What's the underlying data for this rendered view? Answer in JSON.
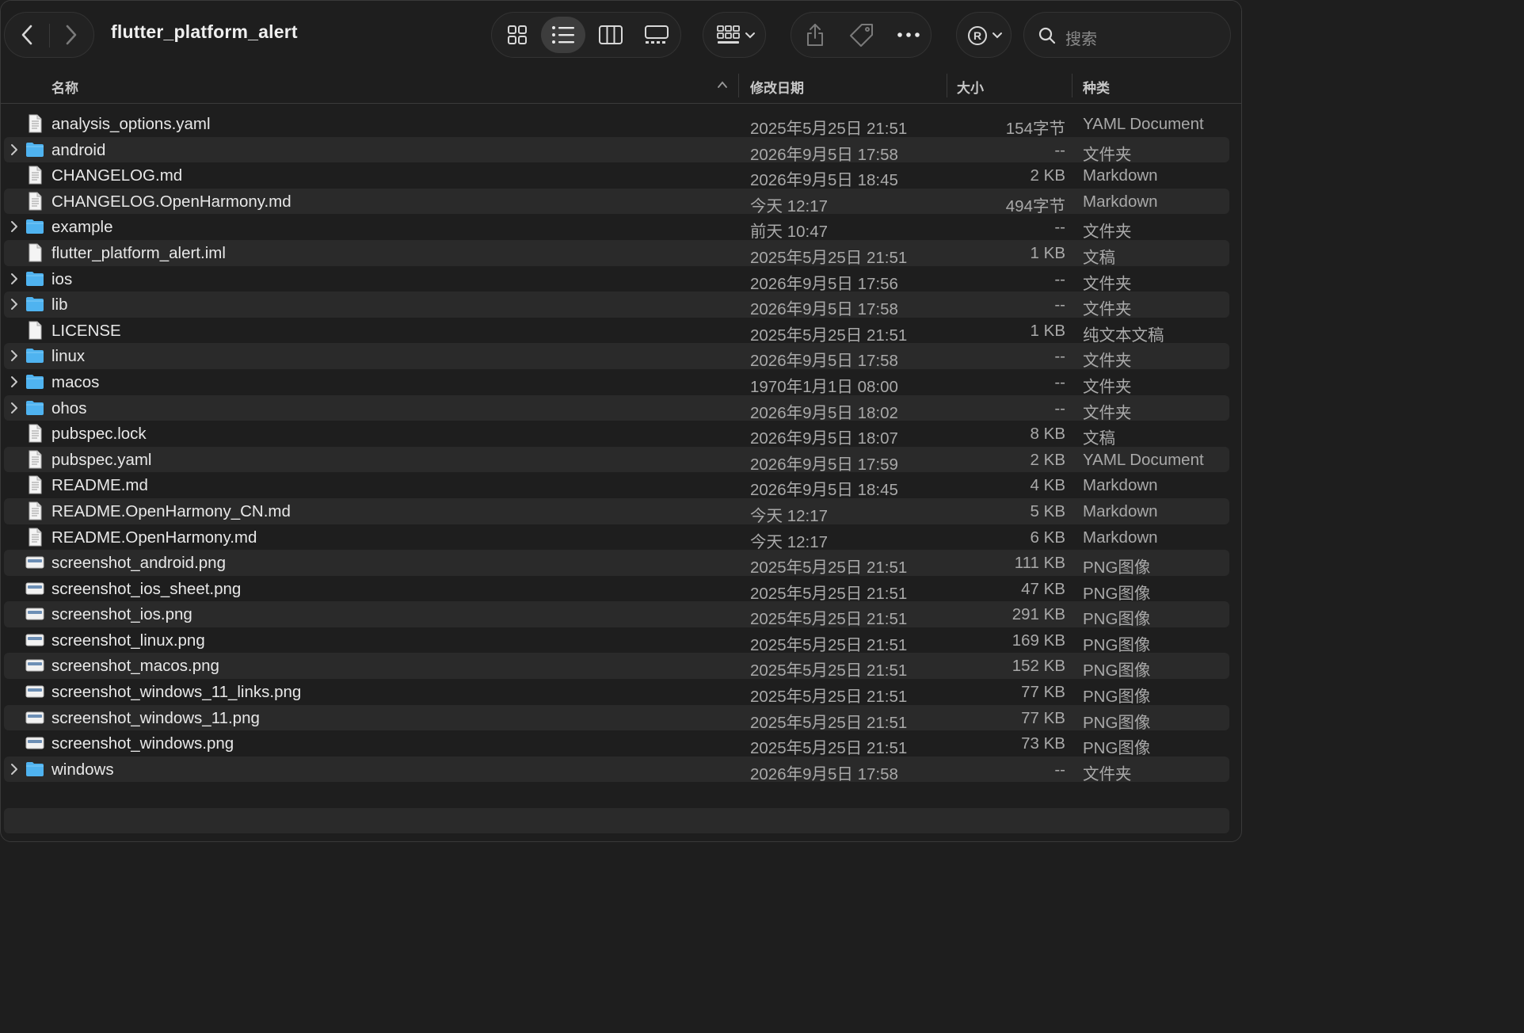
{
  "window": {
    "title": "flutter_platform_alert"
  },
  "toolbar": {
    "back_icon": "chevron-left-icon",
    "forward_icon": "chevron-right-icon",
    "view_modes": [
      "icon-view",
      "list-view",
      "column-view",
      "gallery-view"
    ],
    "active_view": "list-view",
    "search": {
      "placeholder": "搜索"
    }
  },
  "columns": {
    "name": "名称",
    "date": "修改日期",
    "size": "大小",
    "kind": "种类",
    "sort_indicator": "^"
  },
  "files": [
    {
      "name": "analysis_options.yaml",
      "date": "2025年5月25日 21:51",
      "size": "154字节",
      "kind": "YAML Document",
      "type": "doc",
      "folder": false
    },
    {
      "name": "android",
      "date": "2026年9月5日 17:58",
      "size": "--",
      "kind": "文件夹",
      "type": "folder",
      "folder": true
    },
    {
      "name": "CHANGELOG.md",
      "date": "2026年9月5日 18:45",
      "size": "2 KB",
      "kind": "Markdown",
      "type": "doc",
      "folder": false
    },
    {
      "name": "CHANGELOG.OpenHarmony.md",
      "date": "今天 12:17",
      "size": "494字节",
      "kind": "Markdown",
      "type": "doc",
      "folder": false
    },
    {
      "name": "example",
      "date": "前天 10:47",
      "size": "--",
      "kind": "文件夹",
      "type": "folder",
      "folder": true
    },
    {
      "name": "flutter_platform_alert.iml",
      "date": "2025年5月25日 21:51",
      "size": "1 KB",
      "kind": "文稿",
      "type": "blank",
      "folder": false
    },
    {
      "name": "ios",
      "date": "2026年9月5日 17:56",
      "size": "--",
      "kind": "文件夹",
      "type": "folder",
      "folder": true
    },
    {
      "name": "lib",
      "date": "2026年9月5日 17:58",
      "size": "--",
      "kind": "文件夹",
      "type": "folder",
      "folder": true
    },
    {
      "name": "LICENSE",
      "date": "2025年5月25日 21:51",
      "size": "1 KB",
      "kind": "纯文本文稿",
      "type": "blank",
      "folder": false
    },
    {
      "name": "linux",
      "date": "2026年9月5日 17:58",
      "size": "--",
      "kind": "文件夹",
      "type": "folder",
      "folder": true
    },
    {
      "name": "macos",
      "date": "1970年1月1日 08:00",
      "size": "--",
      "kind": "文件夹",
      "type": "folder",
      "folder": true
    },
    {
      "name": "ohos",
      "date": "2026年9月5日 18:02",
      "size": "--",
      "kind": "文件夹",
      "type": "folder",
      "folder": true
    },
    {
      "name": "pubspec.lock",
      "date": "2026年9月5日 18:07",
      "size": "8 KB",
      "kind": "文稿",
      "type": "doc",
      "folder": false
    },
    {
      "name": "pubspec.yaml",
      "date": "2026年9月5日 17:59",
      "size": "2 KB",
      "kind": "YAML Document",
      "type": "doc",
      "folder": false
    },
    {
      "name": "README.md",
      "date": "2026年9月5日 18:45",
      "size": "4 KB",
      "kind": "Markdown",
      "type": "doc",
      "folder": false
    },
    {
      "name": "README.OpenHarmony_CN.md",
      "date": "今天 12:17",
      "size": "5 KB",
      "kind": "Markdown",
      "type": "doc",
      "folder": false
    },
    {
      "name": "README.OpenHarmony.md",
      "date": "今天 12:17",
      "size": "6 KB",
      "kind": "Markdown",
      "type": "doc",
      "folder": false
    },
    {
      "name": "screenshot_android.png",
      "date": "2025年5月25日 21:51",
      "size": "111 KB",
      "kind": "PNG图像",
      "type": "image",
      "folder": false
    },
    {
      "name": "screenshot_ios_sheet.png",
      "date": "2025年5月25日 21:51",
      "size": "47 KB",
      "kind": "PNG图像",
      "type": "image",
      "folder": false
    },
    {
      "name": "screenshot_ios.png",
      "date": "2025年5月25日 21:51",
      "size": "291 KB",
      "kind": "PNG图像",
      "type": "image",
      "folder": false
    },
    {
      "name": "screenshot_linux.png",
      "date": "2025年5月25日 21:51",
      "size": "169 KB",
      "kind": "PNG图像",
      "type": "image",
      "folder": false
    },
    {
      "name": "screenshot_macos.png",
      "date": "2025年5月25日 21:51",
      "size": "152 KB",
      "kind": "PNG图像",
      "type": "image",
      "folder": false
    },
    {
      "name": "screenshot_windows_11_links.png",
      "date": "2025年5月25日 21:51",
      "size": "77 KB",
      "kind": "PNG图像",
      "type": "image",
      "folder": false
    },
    {
      "name": "screenshot_windows_11.png",
      "date": "2025年5月25日 21:51",
      "size": "77 KB",
      "kind": "PNG图像",
      "type": "image",
      "folder": false
    },
    {
      "name": "screenshot_windows.png",
      "date": "2025年5月25日 21:51",
      "size": "73 KB",
      "kind": "PNG图像",
      "type": "image",
      "folder": false
    },
    {
      "name": "windows",
      "date": "2026年9月5日 17:58",
      "size": "--",
      "kind": "文件夹",
      "type": "folder",
      "folder": true
    }
  ],
  "colors": {
    "folder": "#4fb3f0",
    "background": "#1e1e1e",
    "row_alt": "#2a2a2a"
  }
}
